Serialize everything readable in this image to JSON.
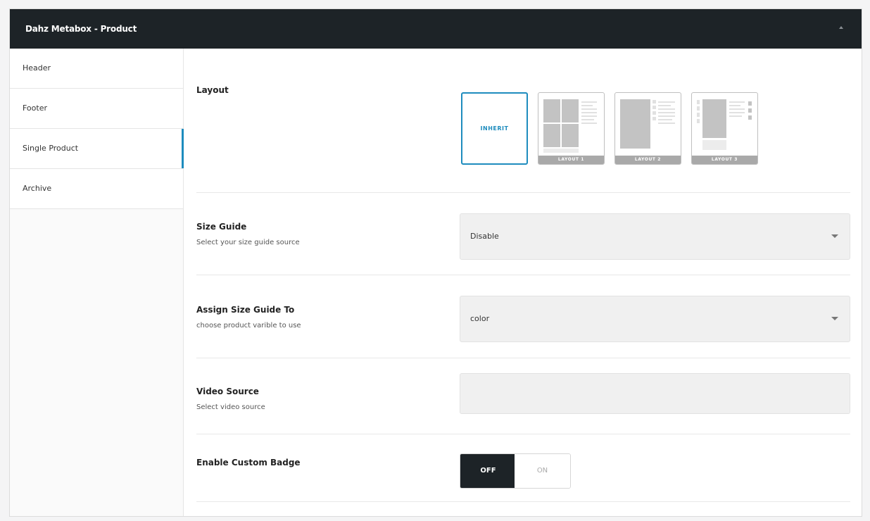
{
  "metabox": {
    "title": "Dahz Metabox - Product"
  },
  "sidebar": {
    "items": [
      {
        "label": "Header",
        "active": false
      },
      {
        "label": "Footer",
        "active": false
      },
      {
        "label": "Single Product",
        "active": true
      },
      {
        "label": "Archive",
        "active": false
      }
    ]
  },
  "layout": {
    "title": "Layout",
    "selected": "INHERIT",
    "options": [
      {
        "label": "INHERIT"
      },
      {
        "label": "LAYOUT 1"
      },
      {
        "label": "LAYOUT 2"
      },
      {
        "label": "LAYOUT 3"
      }
    ]
  },
  "size_guide": {
    "title": "Size Guide",
    "description": "Select your size guide source",
    "value": "Disable"
  },
  "assign_size_guide": {
    "title": "Assign Size Guide To",
    "description": "choose product varible to use",
    "value": "color"
  },
  "video_source": {
    "title": "Video Source",
    "description": "Select video source",
    "value": ""
  },
  "custom_badge": {
    "title": "Enable Custom Badge",
    "off_label": "OFF",
    "on_label": "ON",
    "state": "OFF"
  },
  "colors": {
    "header_bg": "#1d2327",
    "accent": "#1e8cbe",
    "toggle_active_bg": "#1d2327"
  },
  "icons": {
    "collapse": "triangle-up-icon",
    "select_caret": "chevron-down-icon"
  }
}
